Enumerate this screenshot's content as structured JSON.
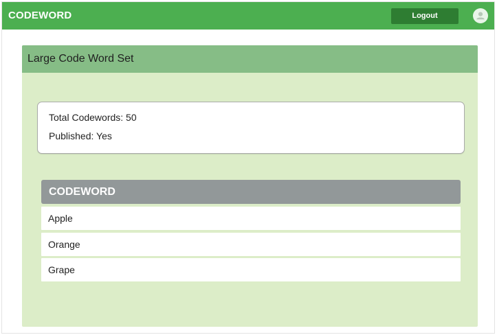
{
  "app": {
    "brand": "CODEWORD",
    "logout_label": "Logout"
  },
  "icons": {
    "avatar": "user-avatar-icon"
  },
  "colors": {
    "topbar": "#4caf50",
    "logout_button": "#2e7d32",
    "card_background": "#dcedc8",
    "card_header": "#86bd86",
    "table_header": "#929899"
  },
  "card": {
    "title": "Large Code Word Set",
    "info": {
      "total": "Total Codewords: 50",
      "published": "Published: Yes"
    },
    "table": {
      "header": "CODEWORD",
      "rows": [
        "Apple",
        "Orange",
        "Grape"
      ]
    }
  }
}
